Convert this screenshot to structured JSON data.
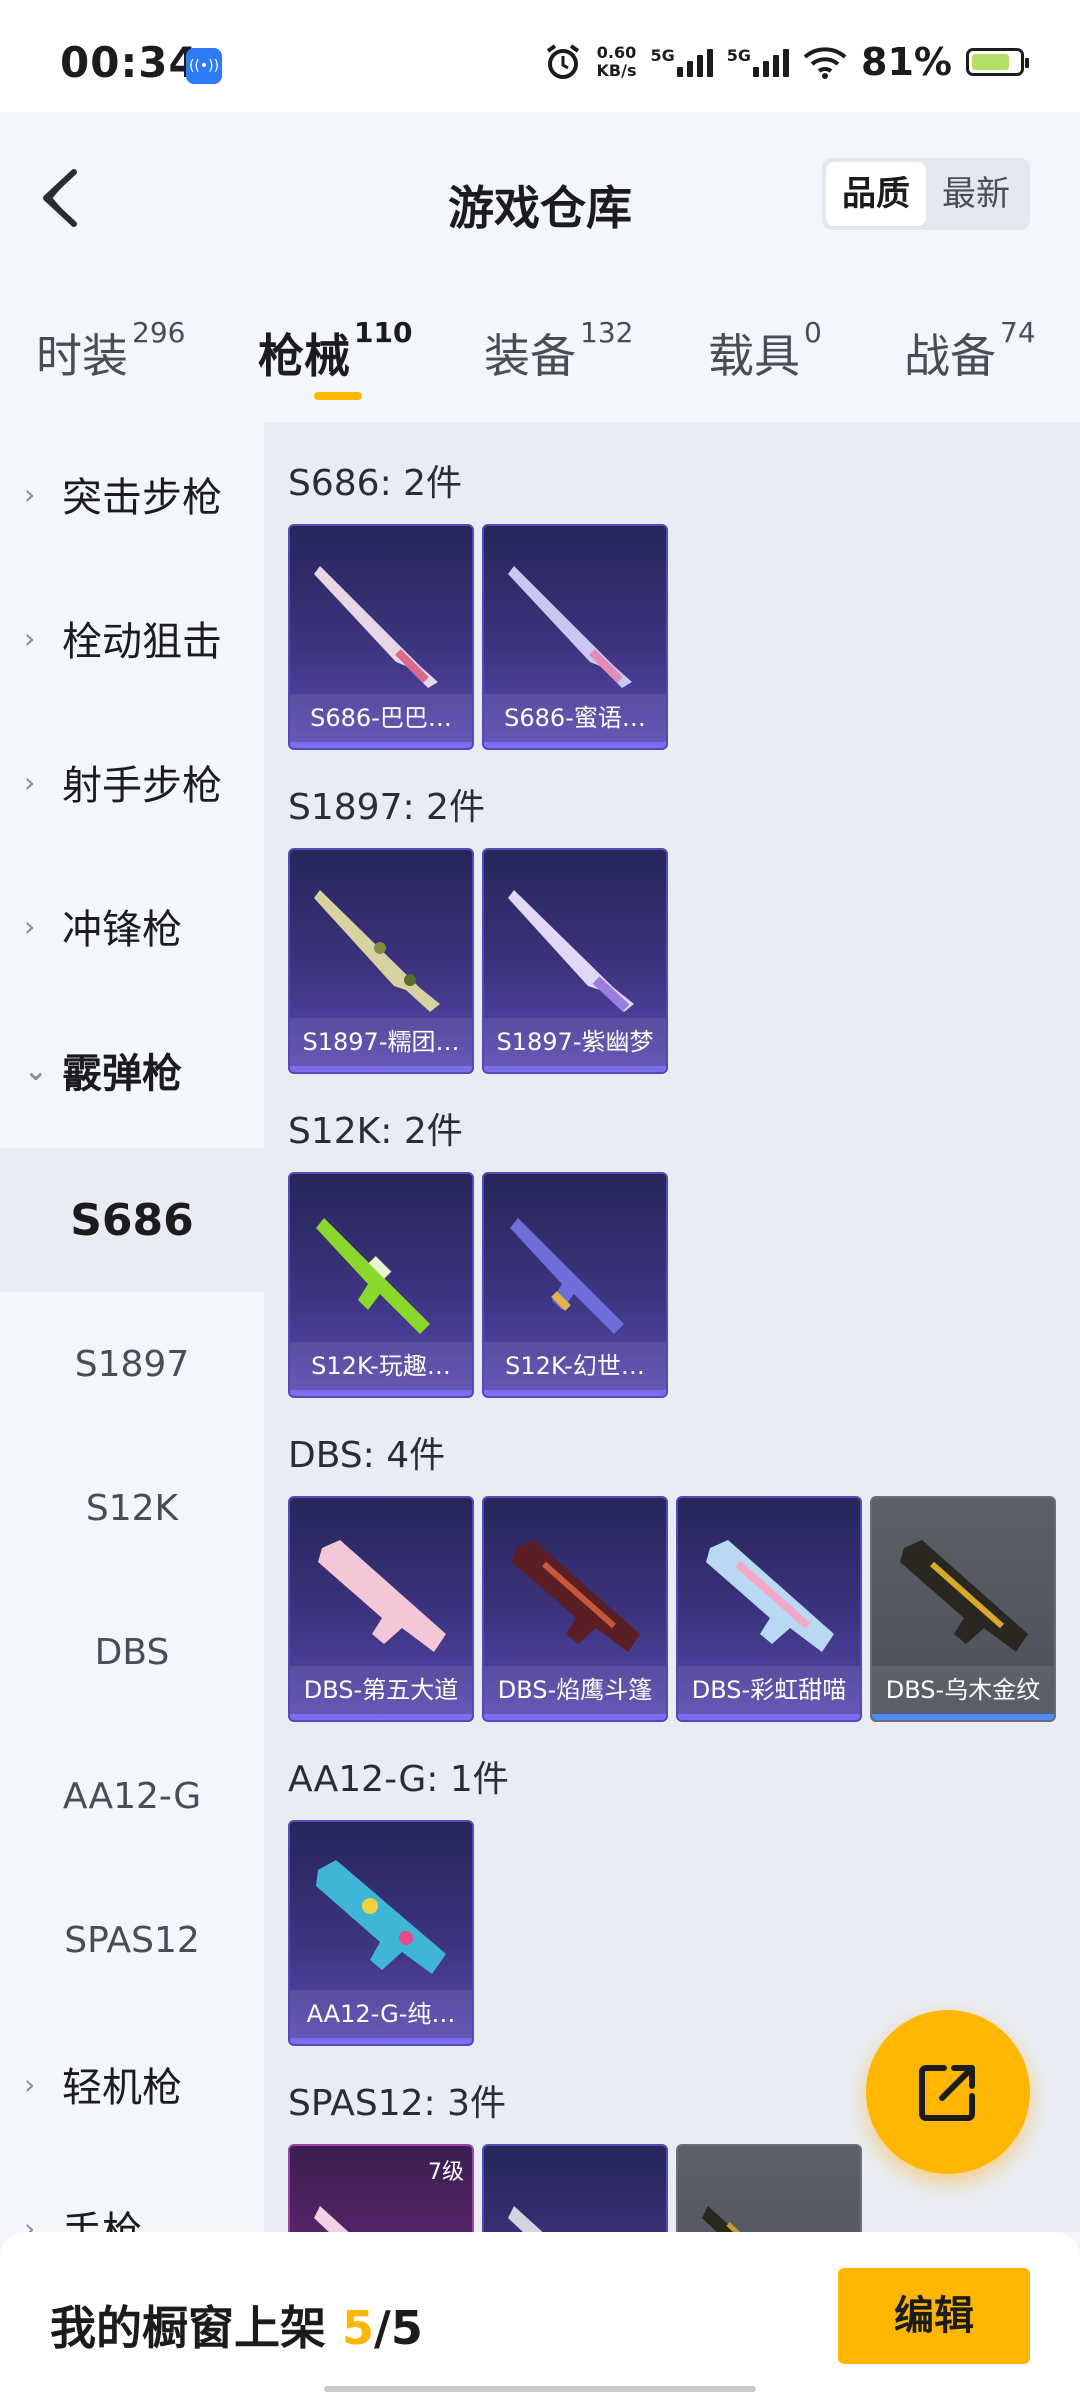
{
  "status": {
    "time": "00:34",
    "speed_value": "0.60",
    "speed_unit": "KB/s",
    "net1": "5G",
    "net2": "5G",
    "battery": "81%",
    "battery_level": 0.81
  },
  "header": {
    "title": "游戏仓库",
    "sort_options": [
      "品质",
      "最新"
    ],
    "sort_selected": "品质"
  },
  "tabs": [
    {
      "label": "时装",
      "count": "296"
    },
    {
      "label": "枪械",
      "count": "110",
      "active": true
    },
    {
      "label": "装备",
      "count": "132"
    },
    {
      "label": "载具",
      "count": "0"
    },
    {
      "label": "战备",
      "count": "74"
    }
  ],
  "sidebar": {
    "categories": [
      "突击步枪",
      "栓动狙击",
      "射手步枪",
      "冲锋枪",
      "霰弹枪"
    ],
    "subitems": [
      "S686",
      "S1897",
      "S12K",
      "DBS",
      "AA12-G",
      "SPAS12"
    ],
    "bottom_categories": [
      "轻机枪",
      "手枪"
    ],
    "selected": "S686"
  },
  "groups": [
    {
      "title": "S686: 2件",
      "items": [
        "S686-巴巴…",
        "S686-蜜语…"
      ]
    },
    {
      "title": "S1897: 2件",
      "items": [
        "S1897-糯团…",
        "S1897-紫幽梦"
      ]
    },
    {
      "title": "S12K: 2件",
      "items": [
        "S12K-玩趣…",
        "S12K-幻世…"
      ]
    },
    {
      "title": "DBS: 4件",
      "items": [
        "DBS-第五大道",
        "DBS-焰鹰斗篷",
        "DBS-彩虹甜喵",
        "DBS-乌木金纹"
      ]
    },
    {
      "title": "AA12-G: 1件",
      "items": [
        "AA12-G-纯…"
      ]
    },
    {
      "title": "SPAS12: 3件",
      "level_badge": "7级"
    }
  ],
  "footer": {
    "prefix": "我的橱窗上架 ",
    "count": "5",
    "sep": "/",
    "total": "5",
    "edit_label": "编辑"
  },
  "colors": {
    "accent": "#ffb600",
    "card_purple": "#3d3480",
    "card_grey": "#52565e"
  }
}
